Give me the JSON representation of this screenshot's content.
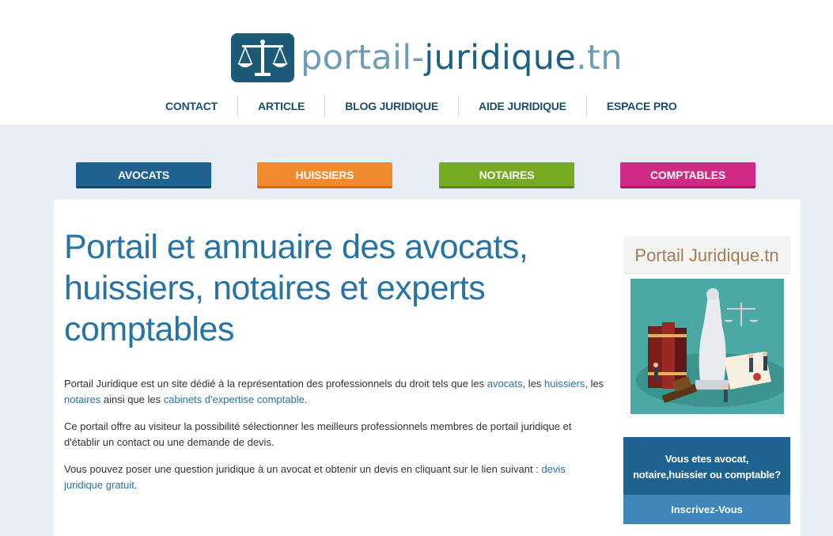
{
  "logo": {
    "part1": "portail-",
    "part2": "juridique",
    "part3": ".tn",
    "icon": "scales-of-justice-icon"
  },
  "nav": {
    "items": [
      "CONTACT",
      "ARTICLE",
      "BLOG JURIDIQUE",
      "AIDE JURIDIQUE",
      "ESPACE PRO"
    ]
  },
  "categories": {
    "avocats": "AVOCATS",
    "huissiers": "HUISSIERS",
    "notaires": "NOTAIRES",
    "comptables": "COMPTABLES"
  },
  "colors": {
    "avocats": "#1e6390",
    "huissiers": "#f08a2c",
    "notaires": "#76aa21",
    "comptables": "#cf2a85",
    "title": "#2873a1"
  },
  "main": {
    "title": "Portail et annuaire des avocats, huissiers, notaires et experts comptables",
    "p1": {
      "t1": "Portail Juridique est un site dédié à la représentation des professionnels du droit tels que les ",
      "link1": "avocats",
      "t2": ", les ",
      "link2": "huissiers",
      "t3": ", les ",
      "link3": "notaires",
      "t4": " ainsi que les ",
      "link4": "cabinets d'expertise comptable",
      "t5": "."
    },
    "p2": "Ce portail offre au visiteur la possibilité sélectionner les meilleurs professionnels membres de portail juridique et d'établir un contact ou une demande de devis.",
    "p3": {
      "t1": "Vous pouvez poser une question juridique à un avocat et obtenir un devis en cliquant sur le lien suivant : ",
      "link": "devis juridique gratuit",
      "t2": "."
    }
  },
  "sidebar": {
    "title": "Portail Juridique.tn",
    "image": "lady-justice-illustration",
    "cta_text": "Vous etes avocat, notaire,huissier ou comptable?",
    "cta_button": "Inscrivez-Vous"
  }
}
